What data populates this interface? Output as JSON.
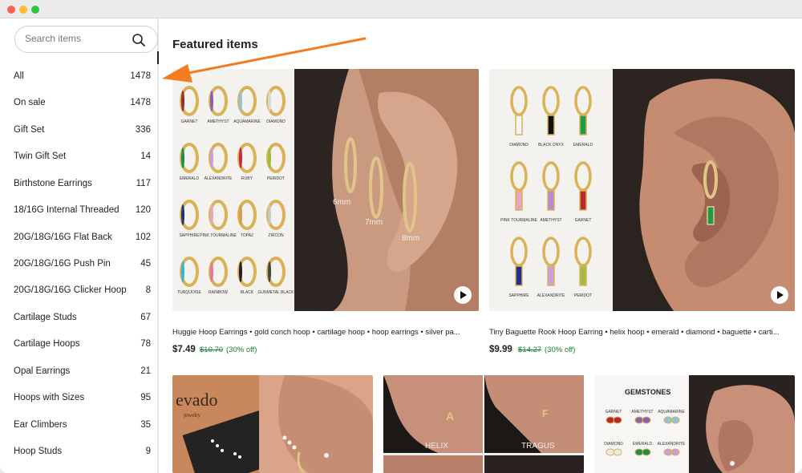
{
  "search": {
    "placeholder": "Search items"
  },
  "categories": [
    {
      "label": "All",
      "count": "1478"
    },
    {
      "label": "On sale",
      "count": "1478"
    },
    {
      "label": "Gift Set",
      "count": "336"
    },
    {
      "label": "Twin Gift Set",
      "count": "14"
    },
    {
      "label": "Birthstone Earrings",
      "count": "117"
    },
    {
      "label": "18/16G Internal Threaded",
      "count": "120"
    },
    {
      "label": "20G/18G/16G Flat Back",
      "count": "102"
    },
    {
      "label": "20G/18G/16G Push Pin",
      "count": "45"
    },
    {
      "label": "20G/18G/16G Clicker Hoop",
      "count": "8"
    },
    {
      "label": "Cartilage Studs",
      "count": "67"
    },
    {
      "label": "Cartilage Hoops",
      "count": "78"
    },
    {
      "label": "Opal Earrings",
      "count": "21"
    },
    {
      "label": "Hoops with Sizes",
      "count": "95"
    },
    {
      "label": "Ear Climbers",
      "count": "35"
    },
    {
      "label": "Hoop Studs",
      "count": "9"
    }
  ],
  "main": {
    "title": "Featured items"
  },
  "featured": [
    {
      "title": "Huggie Hoop Earrings • gold conch hoop • cartilage hoop • hoop earrings • silver pa...",
      "price": "$7.49",
      "old_price": "$10.70",
      "discount": "(30% off)",
      "gem_labels": [
        "GARNET",
        "AMETHYST",
        "AQUAMARINE",
        "DIAMOND",
        "EMERALD",
        "ALEXANDRITE",
        "RUBY",
        "PERIDOT",
        "SAPPHIRE",
        "PINK TOURMALINE",
        "TOPAZ",
        "ZIRCON",
        "TURQUOISE",
        "RAINBOW",
        "BLACK",
        "GUNMETAL BLACK"
      ],
      "size_labels": [
        "6mm",
        "7mm",
        "8mm"
      ]
    },
    {
      "title": "Tiny Baguette Rook Hoop Earring • helix hoop • emerald • diamond • baguette • carti...",
      "price": "$9.99",
      "old_price": "$14.27",
      "discount": "(30% off)",
      "gem_labels": [
        "DIAMOND",
        "BLACK ONYX",
        "EMERALD",
        "PINK TOURMALINE",
        "AMETHYST",
        "GARNET",
        "SAPPHIRE",
        "ALEXANDRITE",
        "PERIDOT"
      ]
    }
  ],
  "bottom": {
    "brand_text": "evado",
    "brand_sub": "jewelry",
    "ear_labels": [
      "HELIX",
      "TRAGUS"
    ],
    "gemstones_title": "GEMSTONES",
    "gemstone_names": [
      "GARNET",
      "AMETHYST",
      "AQUAMARINE",
      "DIAMOND",
      "EMERALD",
      "ALEXANDRITE"
    ]
  },
  "colors": {
    "accent_arrow": "#f47c20",
    "sale_green": "#1a7c3c"
  }
}
